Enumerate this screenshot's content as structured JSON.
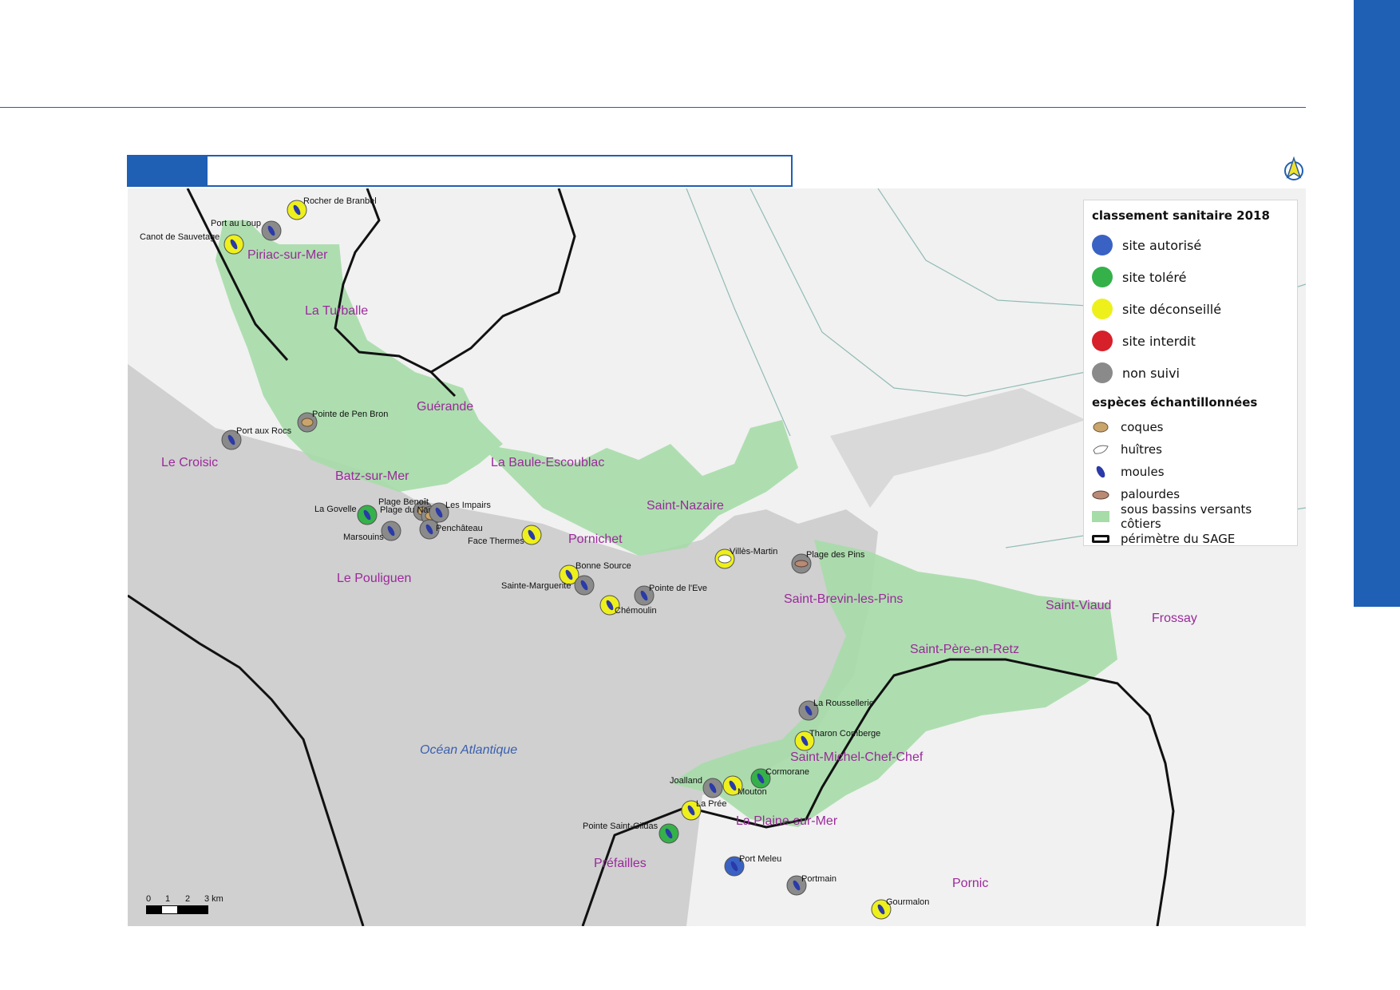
{
  "page": {
    "title_bar_text": ""
  },
  "map": {
    "sea_label": "Océan Atlantique",
    "communes": [
      "Piriac-sur-Mer",
      "La Turballe",
      "Guérande",
      "Le Croisic",
      "Batz-sur-Mer",
      "La Baule-Escoublac",
      "Saint-Nazaire",
      "Pornichet",
      "Le Pouliguen",
      "Saint-Brevin-les-Pins",
      "Saint-Viaud",
      "Frossay",
      "Saint-Père-en-Retz",
      "Saint-Michel-Chef-Chef",
      "La Plaine-sur-Mer",
      "Préfailles",
      "Pornic"
    ],
    "sites": [
      {
        "name": "Rocher de Branbel",
        "class": "déconseillé",
        "species": "moules"
      },
      {
        "name": "Port au Loup",
        "class": "non suivi",
        "species": "moules"
      },
      {
        "name": "Canot de Sauvetage",
        "class": "déconseillé",
        "species": "moules"
      },
      {
        "name": "Pointe de Pen Bron",
        "class": "non suivi",
        "species": "coques"
      },
      {
        "name": "Port aux Rocs",
        "class": "non suivi",
        "species": "moules"
      },
      {
        "name": "Plage Benoît",
        "class": "non suivi",
        "species": "coques"
      },
      {
        "name": "Plage du Nau",
        "class": "non suivi",
        "species": "coques"
      },
      {
        "name": "La Govelle",
        "class": "toléré",
        "species": "moules"
      },
      {
        "name": "Les Impairs",
        "class": "non suivi",
        "species": "moules"
      },
      {
        "name": "Marsouins",
        "class": "non suivi",
        "species": "moules"
      },
      {
        "name": "Penchâteau",
        "class": "non suivi",
        "species": "moules"
      },
      {
        "name": "Face Thermes",
        "class": "déconseillé",
        "species": "moules"
      },
      {
        "name": "Bonne Source",
        "class": "déconseillé",
        "species": "moules"
      },
      {
        "name": "Sainte-Marguerite",
        "class": "non suivi",
        "species": "moules"
      },
      {
        "name": "Pointe de l'Eve",
        "class": "non suivi",
        "species": "moules"
      },
      {
        "name": "Chémoulin",
        "class": "déconseillé",
        "species": "moules"
      },
      {
        "name": "Villès-Martin",
        "class": "déconseillé",
        "species": "huîtres"
      },
      {
        "name": "Plage des Pins",
        "class": "non suivi",
        "species": "palourdes"
      },
      {
        "name": "La Roussellerie",
        "class": "non suivi",
        "species": "moules"
      },
      {
        "name": "Tharon Comberge",
        "class": "déconseillé",
        "species": "moules"
      },
      {
        "name": "Cormorane",
        "class": "toléré",
        "species": "moules"
      },
      {
        "name": "Joalland",
        "class": "non suivi",
        "species": "moules"
      },
      {
        "name": "Mouton",
        "class": "déconseillé",
        "species": "moules"
      },
      {
        "name": "La Prée",
        "class": "déconseillé",
        "species": "moules"
      },
      {
        "name": "Pointe Saint-Gildas",
        "class": "toléré",
        "species": "moules"
      },
      {
        "name": "Port Meleu",
        "class": "autorisé",
        "species": "moules"
      },
      {
        "name": "Portmain",
        "class": "non suivi",
        "species": "moules"
      },
      {
        "name": "Gourmalon",
        "class": "déconseillé",
        "species": "moules"
      }
    ],
    "scale": {
      "ticks": [
        "0",
        "1",
        "2",
        "3 km"
      ]
    }
  },
  "legend": {
    "title_classement": "classement sanitaire 2018",
    "classes": [
      {
        "label": "site autorisé",
        "color": "#3a62c4"
      },
      {
        "label": "site toléré",
        "color": "#35b14a"
      },
      {
        "label": "site déconseillé",
        "color": "#eef01c"
      },
      {
        "label": "site interdit",
        "color": "#d6202a"
      },
      {
        "label": "non suivi",
        "color": "#8a8a8a"
      }
    ],
    "title_especes": "espèces échantillonnées",
    "species": [
      {
        "label": "coques",
        "icon": "cockle-icon"
      },
      {
        "label": "huîtres",
        "icon": "oyster-icon"
      },
      {
        "label": "moules",
        "icon": "mussel-icon"
      },
      {
        "label": "palourdes",
        "icon": "clam-icon"
      }
    ],
    "zone_label": "sous bassins versants côtiers",
    "zone_color": "#a6dca8",
    "perimeter_label": "périmètre du SAGE"
  }
}
